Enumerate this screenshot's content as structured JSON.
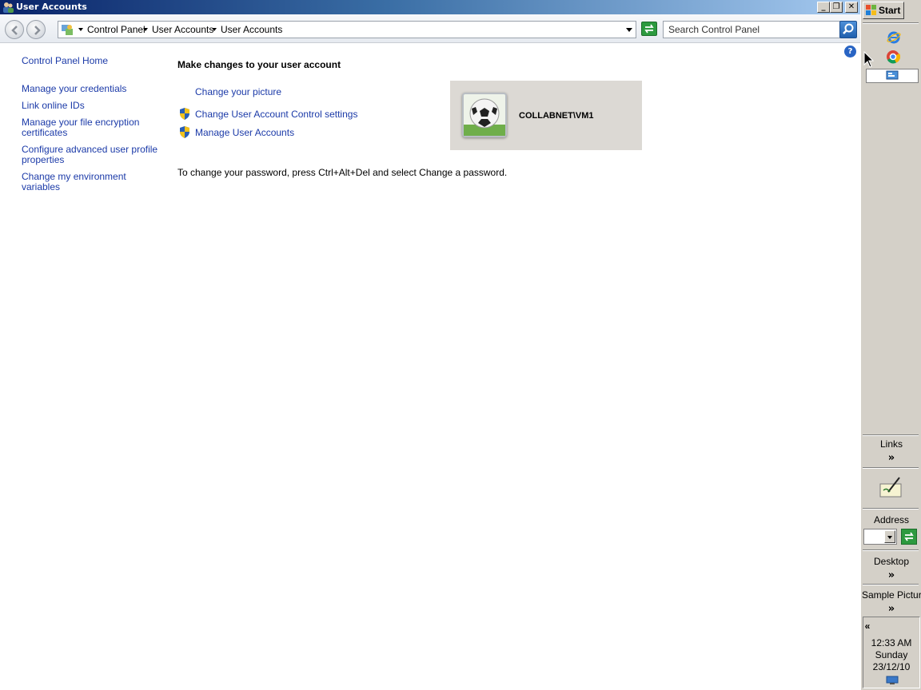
{
  "window": {
    "title": "User Accounts",
    "controls": {
      "minimize": "_",
      "restore": "❐",
      "close": "✕"
    }
  },
  "toolbar": {
    "breadcrumbs": [
      "Control Panel",
      "User Accounts",
      "User Accounts"
    ],
    "search_placeholder": "Search Control Panel"
  },
  "sidebar": {
    "home": "Control Panel Home",
    "items": [
      "Manage your credentials",
      "Link online IDs",
      "Manage your file encryption",
      "certificates",
      "Configure advanced user profile",
      "properties",
      "Change my environment variables"
    ]
  },
  "main": {
    "heading": "Make changes to your user account",
    "tasks": [
      "Change your picture",
      "Change User Account Control settings",
      "Manage User Accounts"
    ],
    "note": "To change your password, press Ctrl+Alt+Del and select Change a password.",
    "user": {
      "name": "COLLABNET\\VM1",
      "picture_icon": "soccer-ball-icon"
    },
    "help": "?"
  },
  "taskbar": {
    "start_label": "Start",
    "quick_launch": [
      "internet-explorer-icon",
      "chrome-icon",
      "show-desktop-icon"
    ],
    "links_label": "Links",
    "address_label": "Address",
    "desktop_label": "Desktop",
    "sample_pictures_label": "Sample Pictures",
    "chevron": "»",
    "tray_chevron": "«",
    "time": "12:33 AM",
    "day": "Sunday",
    "date": "23/12/10"
  },
  "colors": {
    "link": "#1b3aa8",
    "titlebar": "#0a246a",
    "taskbar": "#d4d0c8",
    "user_panel": "#dcd9d4"
  }
}
